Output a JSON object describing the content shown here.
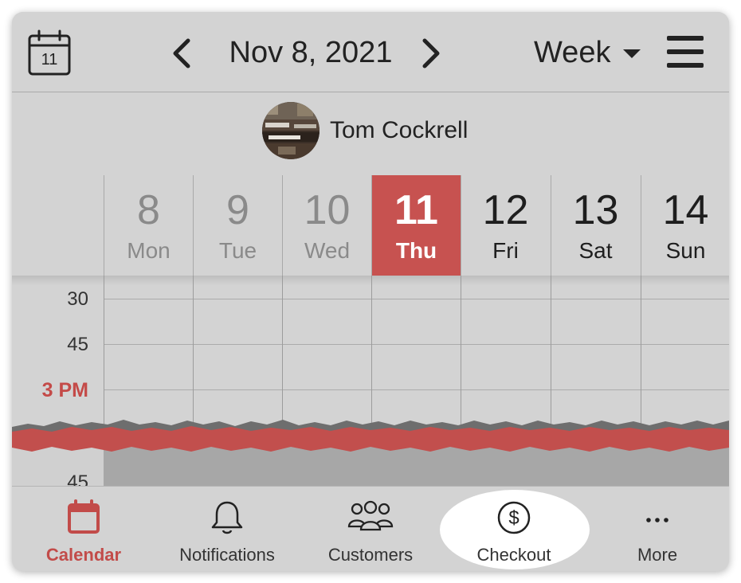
{
  "header": {
    "calendar_icon_day": "11",
    "date_title": "Nov 8, 2021",
    "view_label": "Week"
  },
  "staff": {
    "name": "Tom Cockrell"
  },
  "days": [
    {
      "num": "8",
      "name": "Mon"
    },
    {
      "num": "9",
      "name": "Tue"
    },
    {
      "num": "10",
      "name": "Wed"
    },
    {
      "num": "11",
      "name": "Thu"
    },
    {
      "num": "12",
      "name": "Fri"
    },
    {
      "num": "13",
      "name": "Sat"
    },
    {
      "num": "14",
      "name": "Sun"
    }
  ],
  "time_labels": {
    "t1": "30",
    "t2": "45",
    "now": "3 PM",
    "t3": "45"
  },
  "tabs": {
    "calendar": "Calendar",
    "notifications": "Notifications",
    "customers": "Customers",
    "checkout": "Checkout",
    "more": "More"
  },
  "colors": {
    "accent": "#c75250",
    "background": "#d3d3d3",
    "highlight": "#ffffff"
  }
}
